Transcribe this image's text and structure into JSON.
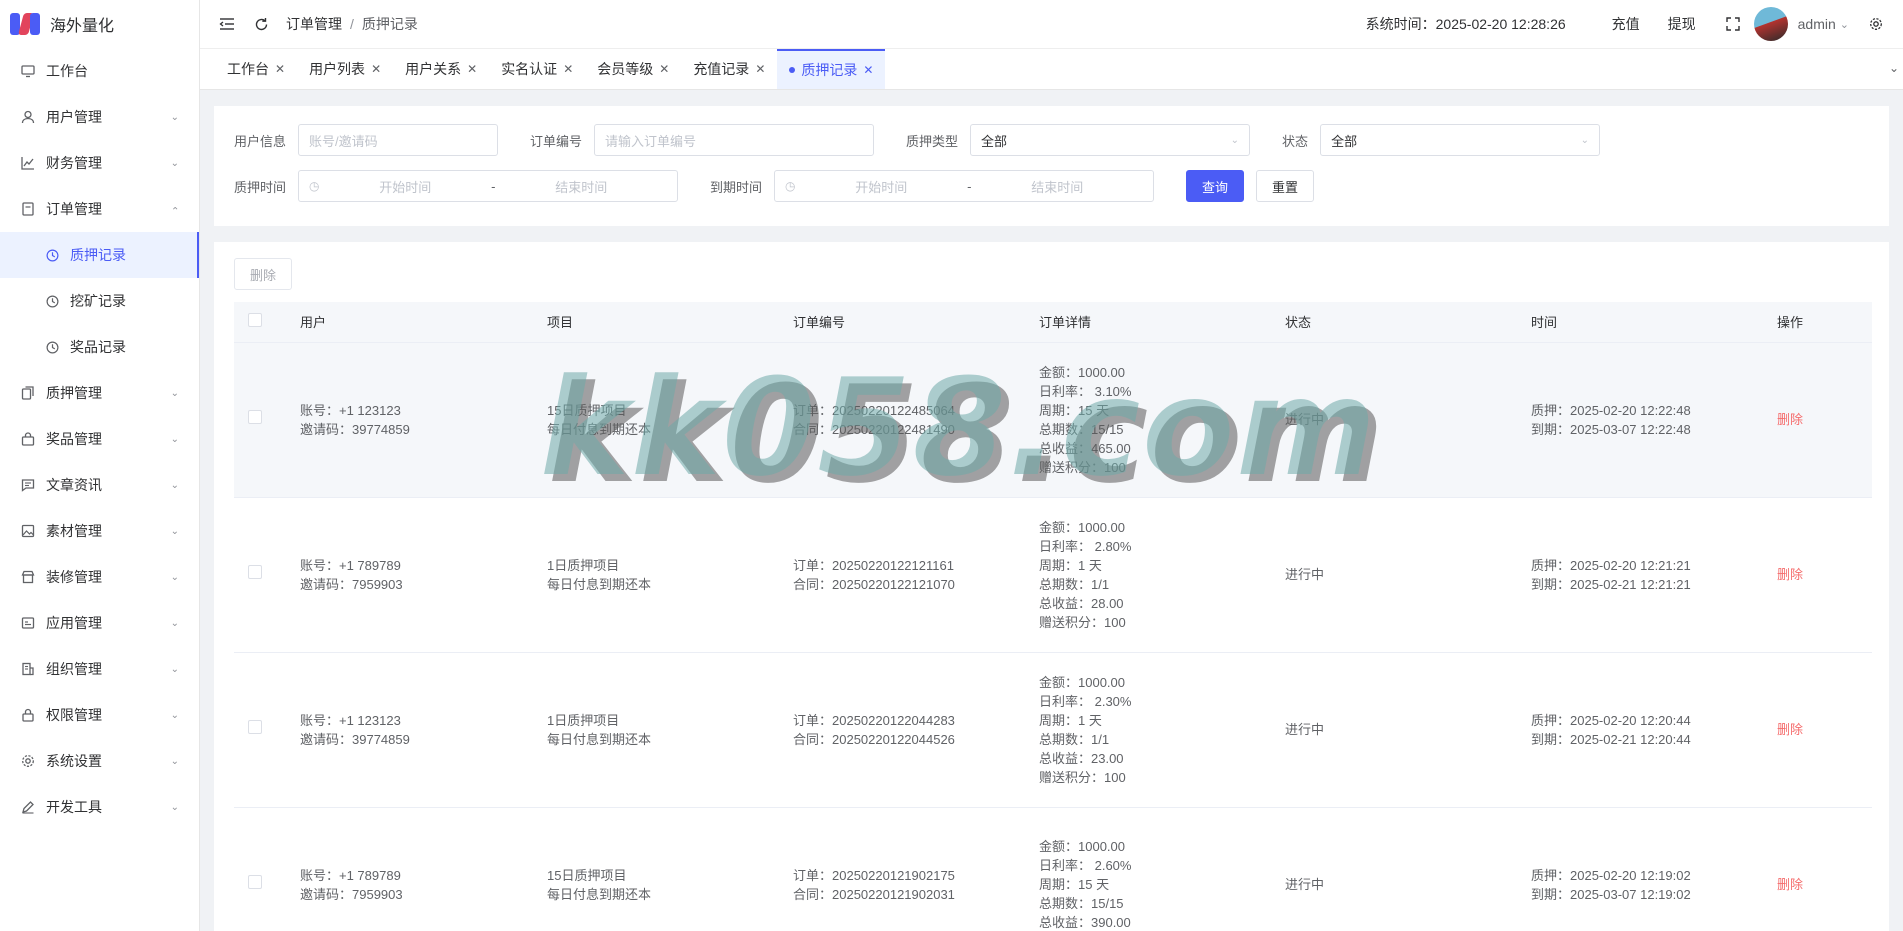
{
  "app": {
    "title": "海外量化"
  },
  "colors": {
    "accent": "#4b5cf5",
    "danger": "#f56c6c",
    "logo_left": "#4b5cf5",
    "logo_right": "#e2445c"
  },
  "sidebar": {
    "items": [
      {
        "label": "工作台",
        "icon": "monitor-icon"
      },
      {
        "label": "用户管理",
        "icon": "user-icon"
      },
      {
        "label": "财务管理",
        "icon": "chart-icon"
      },
      {
        "label": "订单管理",
        "icon": "order-icon",
        "expanded": true
      },
      {
        "label": "质押管理",
        "icon": "copy-icon"
      },
      {
        "label": "奖品管理",
        "icon": "bag-icon"
      },
      {
        "label": "文章资讯",
        "icon": "message-icon"
      },
      {
        "label": "素材管理",
        "icon": "picture-icon"
      },
      {
        "label": "装修管理",
        "icon": "shop-icon"
      },
      {
        "label": "应用管理",
        "icon": "app-icon"
      },
      {
        "label": "组织管理",
        "icon": "building-icon"
      },
      {
        "label": "权限管理",
        "icon": "lock-icon"
      },
      {
        "label": "系统设置",
        "icon": "gear-icon"
      },
      {
        "label": "开发工具",
        "icon": "pen-icon"
      }
    ],
    "order_sub": [
      {
        "label": "质押记录",
        "active": true
      },
      {
        "label": "挖矿记录"
      },
      {
        "label": "奖品记录"
      }
    ]
  },
  "header": {
    "breadcrumb": [
      "订单管理",
      "质押记录"
    ],
    "system_time_label": "系统时间：",
    "system_time": "2025-02-20 12:28:26",
    "recharge": "充值",
    "withdraw": "提现",
    "username": "admin"
  },
  "tabs": [
    {
      "label": "工作台"
    },
    {
      "label": "用户列表"
    },
    {
      "label": "用户关系"
    },
    {
      "label": "实名认证"
    },
    {
      "label": "会员等级"
    },
    {
      "label": "充值记录"
    },
    {
      "label": "质押记录",
      "active": true
    }
  ],
  "filter": {
    "user_info_label": "用户信息",
    "user_info_placeholder": "账号/邀请码",
    "order_no_label": "订单编号",
    "order_no_placeholder": "请输入订单编号",
    "pledge_type_label": "质押类型",
    "pledge_type_value": "全部",
    "status_label": "状态",
    "status_value": "全部",
    "pledge_time_label": "质押时间",
    "expire_time_label": "到期时间",
    "start_placeholder": "开始时间",
    "end_placeholder": "结束时间",
    "range_sep": "-",
    "search": "查询",
    "reset": "重置"
  },
  "table": {
    "delete_button": "删除",
    "headers": [
      "用户",
      "项目",
      "订单编号",
      "订单详情",
      "状态",
      "时间",
      "操作"
    ],
    "rows": [
      {
        "account": "账号：+1 123123",
        "invite": "邀请码：39774859",
        "project": "15日质押项目",
        "project_desc": "每日付息到期还本",
        "order": "订单：20250220122485064",
        "contract": "合同：20250220122481490",
        "details": [
          "金额：1000.00",
          "日利率： 3.10%",
          "周期：15 天",
          "总期数：15/15",
          "总收益：465.00",
          "赠送积分：100"
        ],
        "status": "进行中",
        "pledge_time": "质押：2025-02-20 12:22:48",
        "expire_time": "到期：2025-03-07 12:22:48",
        "action": "删除"
      },
      {
        "account": "账号：+1 789789",
        "invite": "邀请码：7959903",
        "project": "1日质押项目",
        "project_desc": "每日付息到期还本",
        "order": "订单：20250220122121161",
        "contract": "合同：20250220122121070",
        "details": [
          "金额：1000.00",
          "日利率： 2.80%",
          "周期：1 天",
          "总期数：1/1",
          "总收益：28.00",
          "赠送积分：100"
        ],
        "status": "进行中",
        "pledge_time": "质押：2025-02-20 12:21:21",
        "expire_time": "到期：2025-02-21 12:21:21",
        "action": "删除"
      },
      {
        "account": "账号：+1 123123",
        "invite": "邀请码：39774859",
        "project": "1日质押项目",
        "project_desc": "每日付息到期还本",
        "order": "订单：20250220122044283",
        "contract": "合同：20250220122044526",
        "details": [
          "金额：1000.00",
          "日利率： 2.30%",
          "周期：1 天",
          "总期数：1/1",
          "总收益：23.00",
          "赠送积分：100"
        ],
        "status": "进行中",
        "pledge_time": "质押：2025-02-20 12:20:44",
        "expire_time": "到期：2025-02-21 12:20:44",
        "action": "删除"
      },
      {
        "account": "账号：+1 789789",
        "invite": "邀请码：7959903",
        "project": "15日质押项目",
        "project_desc": "每日付息到期还本",
        "order": "订单：20250220121902175",
        "contract": "合同：20250220121902031",
        "details": [
          "金额：1000.00",
          "日利率： 2.60%",
          "周期：15 天",
          "总期数：15/15",
          "总收益：390.00"
        ],
        "status": "进行中",
        "pledge_time": "质押：2025-02-20 12:19:02",
        "expire_time": "到期：2025-03-07 12:19:02",
        "action": "删除"
      }
    ]
  },
  "watermark": "kk058.com"
}
